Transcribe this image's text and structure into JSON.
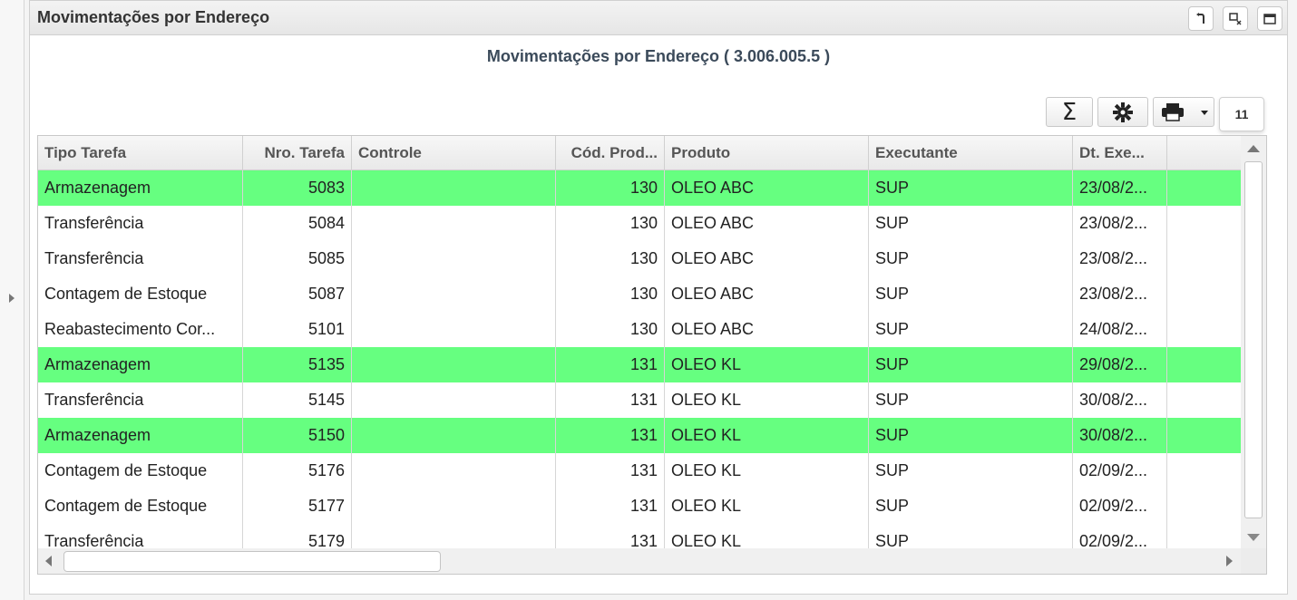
{
  "panel": {
    "title": "Movimentações por Endereço",
    "buttons": [
      "refresh-icon",
      "restore-icon",
      "maximize-icon"
    ]
  },
  "report": {
    "title": "Movimentações por Endereço ( 3.006.005.5 )"
  },
  "toolbar": {
    "sum_icon": "Σ",
    "settings_icon": "gear-icon",
    "print_icon": "printer-icon",
    "count": "11"
  },
  "grid": {
    "highlight_color": "#66ff80",
    "columns": [
      {
        "label": "Tipo Tarefa",
        "align": "left"
      },
      {
        "label": "Nro. Tarefa",
        "align": "right"
      },
      {
        "label": "Controle",
        "align": "left"
      },
      {
        "label": "Cód. Prod...",
        "align": "right"
      },
      {
        "label": "Produto",
        "align": "left"
      },
      {
        "label": "Executante",
        "align": "left"
      },
      {
        "label": "Dt. Exe...",
        "align": "left"
      },
      {
        "label": "",
        "align": "left"
      }
    ],
    "rows": [
      {
        "highlight": true,
        "cells": [
          "Armazenagem",
          "5083",
          "",
          "130",
          "OLEO ABC",
          "SUP",
          "23/08/2...",
          ""
        ]
      },
      {
        "highlight": false,
        "cells": [
          "Transferência",
          "5084",
          "",
          "130",
          "OLEO ABC",
          "SUP",
          "23/08/2...",
          ""
        ]
      },
      {
        "highlight": false,
        "cells": [
          "Transferência",
          "5085",
          "",
          "130",
          "OLEO ABC",
          "SUP",
          "23/08/2...",
          ""
        ]
      },
      {
        "highlight": false,
        "cells": [
          "Contagem de Estoque",
          "5087",
          "",
          "130",
          "OLEO ABC",
          "SUP",
          "23/08/2...",
          ""
        ]
      },
      {
        "highlight": false,
        "cells": [
          "Reabastecimento Cor...",
          "5101",
          "",
          "130",
          "OLEO ABC",
          "SUP",
          "24/08/2...",
          ""
        ]
      },
      {
        "highlight": true,
        "cells": [
          "Armazenagem",
          "5135",
          "",
          "131",
          "OLEO KL",
          "SUP",
          "29/08/2...",
          ""
        ]
      },
      {
        "highlight": false,
        "cells": [
          "Transferência",
          "5145",
          "",
          "131",
          "OLEO KL",
          "SUP",
          "30/08/2...",
          ""
        ]
      },
      {
        "highlight": true,
        "cells": [
          "Armazenagem",
          "5150",
          "",
          "131",
          "OLEO KL",
          "SUP",
          "30/08/2...",
          ""
        ]
      },
      {
        "highlight": false,
        "cells": [
          "Contagem de Estoque",
          "5176",
          "",
          "131",
          "OLEO KL",
          "SUP",
          "02/09/2...",
          ""
        ]
      },
      {
        "highlight": false,
        "cells": [
          "Contagem de Estoque",
          "5177",
          "",
          "131",
          "OLEO KL",
          "SUP",
          "02/09/2...",
          ""
        ]
      },
      {
        "highlight": false,
        "cells": [
          "Transferência",
          "5179",
          "",
          "131",
          "OLEO KL",
          "SUP",
          "02/09/2...",
          ""
        ]
      }
    ]
  }
}
